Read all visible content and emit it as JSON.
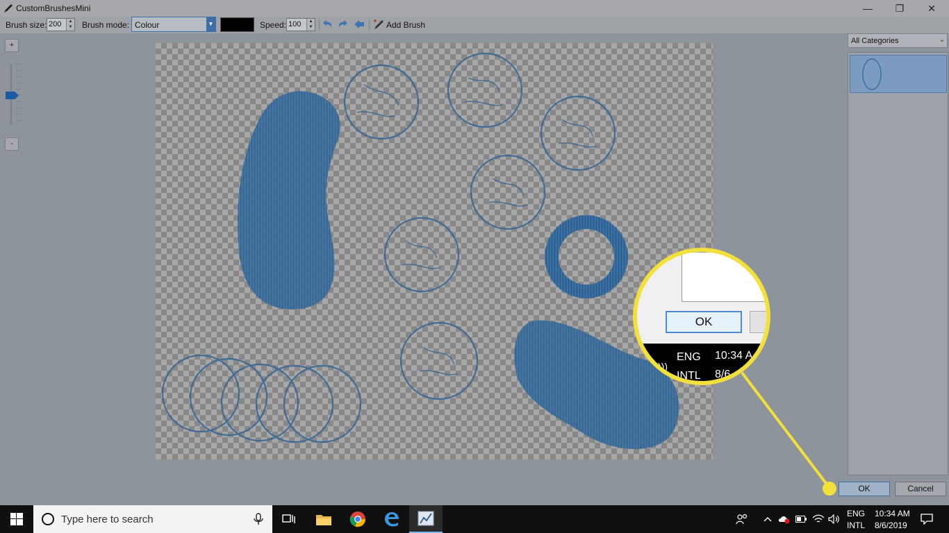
{
  "window": {
    "title": "CustomBrushesMini",
    "controls": {
      "minimize": "—",
      "maximize": "❐",
      "close": "✕"
    }
  },
  "toolbar": {
    "brush_size_label": "Brush size:",
    "brush_size_value": "200",
    "brush_mode_label": "Brush mode:",
    "brush_mode_value": "Colour",
    "colour_swatch": "#000000",
    "speed_label": "Speed:",
    "speed_value": "100",
    "add_brush_label": "Add Brush",
    "icons": [
      "undo-icon",
      "redo-icon",
      "back-arrow-icon",
      "add-brush-icon"
    ]
  },
  "zoom": {
    "plus_label": "+",
    "minus_label": "-"
  },
  "categories": {
    "selected": "All Categories"
  },
  "buttons": {
    "ok": "OK",
    "cancel": "Cancel"
  },
  "callout": {
    "ok_label": "OK",
    "lang_top": "ENG",
    "lang_bottom": "INTL",
    "time": "10:34 A",
    "date": "8/6",
    "accent_color": "#f3e03b"
  },
  "taskbar": {
    "search_placeholder": "Type here to search",
    "apps": [
      "task-view-icon",
      "file-explorer-icon",
      "chrome-icon",
      "edge-icon",
      "paint-net-icon"
    ],
    "lang_top": "ENG",
    "lang_bottom": "INTL",
    "time": "10:34 AM",
    "date": "8/6/2019"
  },
  "colors": {
    "accent": "#3e6fa6",
    "brush": "#2f6494",
    "highlight": "#f3e03b"
  }
}
